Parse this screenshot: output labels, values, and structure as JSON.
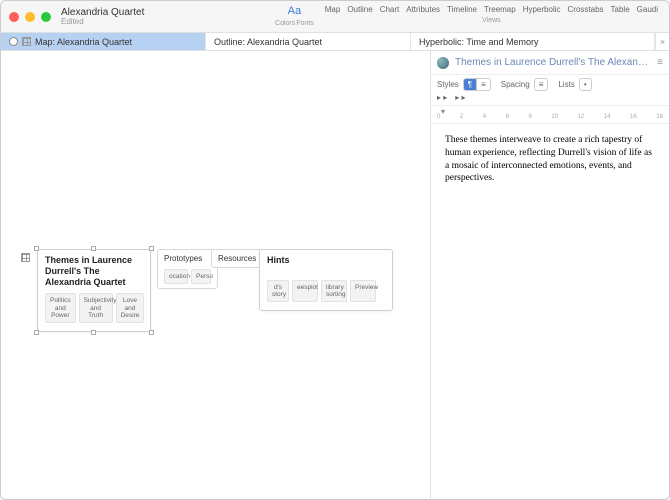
{
  "window": {
    "title": "Alexandria Quartet",
    "subtitle": "Edited"
  },
  "toolbar": {
    "colors_label": "Colors",
    "fonts_label": "Fonts",
    "aa": "Aa",
    "views_label": "Views",
    "views": [
      "Map",
      "Outline",
      "Chart",
      "Attributes",
      "Timeline",
      "Treemap",
      "Hyperbolic",
      "Crosstabs",
      "Table",
      "Gaudi"
    ]
  },
  "tabs": {
    "left": [
      {
        "label": "Map: Alexandria Quartet",
        "active": true
      },
      {
        "label": "Outline: Alexandria Quartet",
        "active": false
      }
    ],
    "right": [
      {
        "label": "Hyperbolic: Time and Memory",
        "active": false
      }
    ]
  },
  "map": {
    "main_card": {
      "title": "Themes in Laurence Durrell's The Alexandria Quartet",
      "children": [
        "Politics and Power",
        "Subjectivity and Truth",
        "Love and Desire"
      ]
    },
    "prototypes": {
      "title": "Prototypes",
      "children": [
        "ocation",
        "Perso"
      ]
    },
    "resources": {
      "title": "Resources"
    },
    "hints": {
      "title": "Hints",
      "children": [
        "d's story",
        "eesplot",
        "library sorting",
        "Preview"
      ]
    }
  },
  "text_pane": {
    "title": "Themes in Laurence Durrell's The Alexandria Quar...",
    "format": {
      "styles_label": "Styles",
      "spacing_label": "Spacing",
      "lists_label": "Lists"
    },
    "ruler_marks": [
      "0",
      "2",
      "4",
      "6",
      "8",
      "10",
      "12",
      "14",
      "16",
      "18"
    ],
    "body": "These themes interweave to create a rich tapestry of human experience, reflecting Durrell's vision of life as a mosaic of interconnected emotions, events, and perspectives."
  }
}
